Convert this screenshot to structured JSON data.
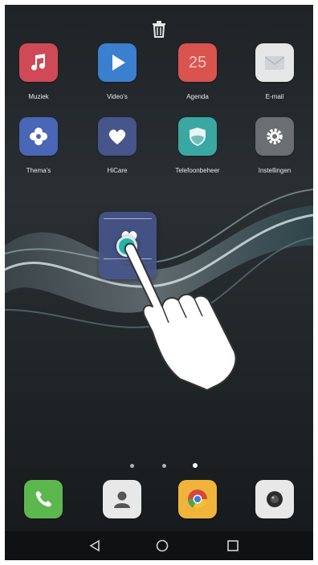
{
  "apps": [
    {
      "name": "music",
      "label": "Muziek",
      "color": "#cf4a56",
      "icon": "music-note-icon"
    },
    {
      "name": "videos",
      "label": "Video's",
      "color": "#3b7fcf",
      "icon": "play-icon"
    },
    {
      "name": "calendar",
      "label": "Agenda",
      "color": "#d9534f",
      "icon": "calendar-icon",
      "date": "25"
    },
    {
      "name": "email",
      "label": "E-mail",
      "color": "#e6e6e6",
      "icon": "envelope-icon"
    },
    {
      "name": "themes",
      "label": "Thema's",
      "color": "#4a66b6",
      "icon": "flower-icon"
    },
    {
      "name": "hicare",
      "label": "HiCare",
      "color": "#46558a",
      "icon": "heart-icon"
    },
    {
      "name": "phone-manager",
      "label": "Telefoonbeheer",
      "color": "#3aa7a3",
      "icon": "shield-icon"
    },
    {
      "name": "settings",
      "label": "Instellingen",
      "color": "#6b6e72",
      "icon": "gear-icon"
    }
  ],
  "dragging_app": {
    "name": "hicare",
    "icon": "heart-icon",
    "color": "#46558a"
  },
  "page_dots": {
    "count": 3,
    "active_index": 2
  },
  "dock": [
    {
      "name": "phone",
      "icon": "phone-icon",
      "color": "#5cb84e"
    },
    {
      "name": "contacts",
      "icon": "contact-icon",
      "color": "#e8e8e8"
    },
    {
      "name": "chrome",
      "icon": "chrome-icon",
      "color": "#f0b43a"
    },
    {
      "name": "camera",
      "icon": "camera-icon",
      "color": "#e8e8e8"
    }
  ],
  "navigation": {
    "back": "back-icon",
    "home": "home-icon",
    "recents": "recents-icon"
  },
  "colors": {
    "touch_indicator": "#1fb6a9",
    "wallpaper": "#22272a"
  }
}
